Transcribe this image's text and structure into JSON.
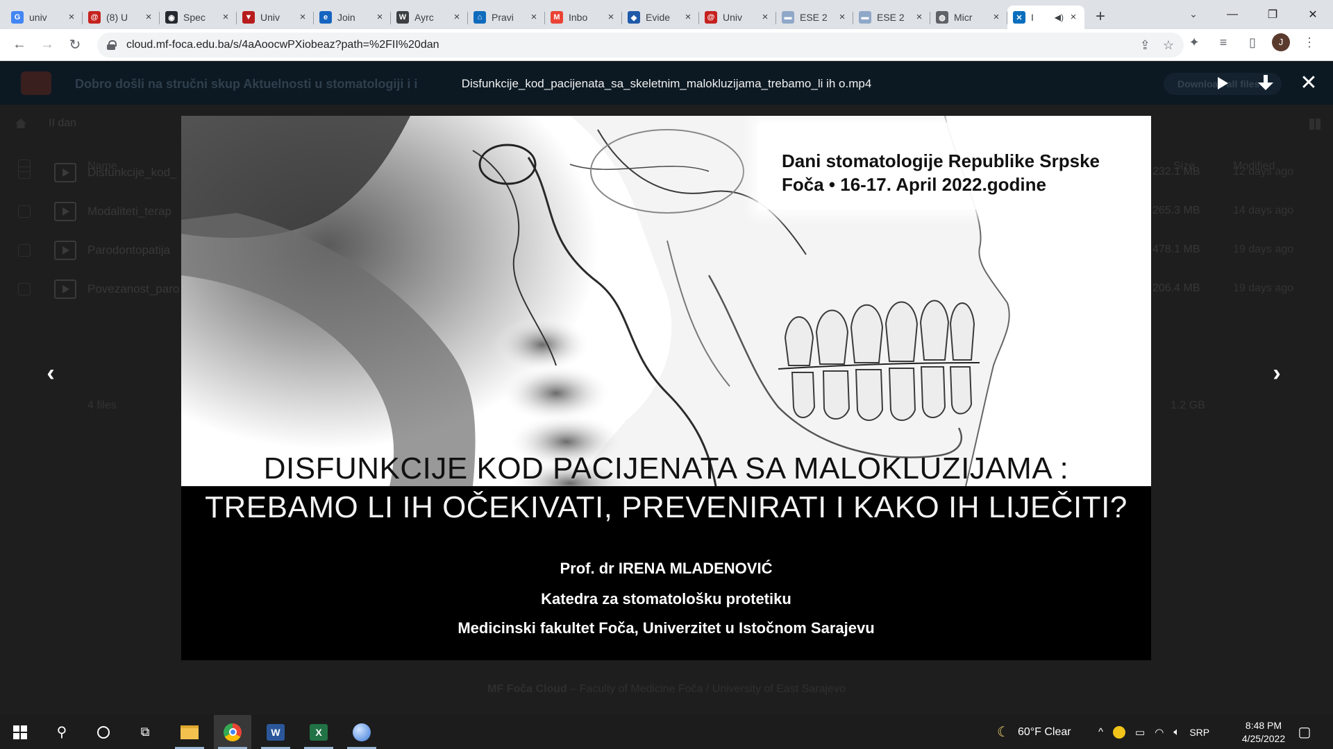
{
  "browser": {
    "tabs": [
      {
        "title": "univ",
        "icon": "google-icon",
        "color": "#4285f4",
        "glyph": "G"
      },
      {
        "title": "(8) U",
        "icon": "mail-icon",
        "color": "#c5221f",
        "glyph": "@"
      },
      {
        "title": "Spec",
        "icon": "github-icon",
        "color": "#24292f",
        "glyph": "◉"
      },
      {
        "title": "Univ",
        "icon": "university-crest-icon",
        "color": "#b71c1c",
        "glyph": "▼"
      },
      {
        "title": "Join",
        "icon": "edge-icon",
        "color": "#1565c0",
        "glyph": "e"
      },
      {
        "title": "Ayrc",
        "icon": "wordpress-icon",
        "color": "#3c4043",
        "glyph": "W"
      },
      {
        "title": "Pravi",
        "icon": "office-icon",
        "color": "#0f6cbd",
        "glyph": "⌂"
      },
      {
        "title": "Inbo",
        "icon": "gmail-icon",
        "color": "#ea4335",
        "glyph": "M"
      },
      {
        "title": "Evide",
        "icon": "shield-icon",
        "color": "#1e5aa8",
        "glyph": "◆"
      },
      {
        "title": "Univ",
        "icon": "mail-icon",
        "color": "#c5221f",
        "glyph": "@"
      },
      {
        "title": "ESE 2",
        "icon": "flag-icon",
        "color": "#8fa8c8",
        "glyph": "▬"
      },
      {
        "title": "ESE 2",
        "icon": "flag-icon",
        "color": "#8fa8c8",
        "glyph": "▬"
      },
      {
        "title": "Micr",
        "icon": "globe-icon",
        "color": "#5f6368",
        "glyph": "◍"
      },
      {
        "title": "I",
        "icon": "nextcloud-icon",
        "color": "#0a6ebd",
        "glyph": "✕",
        "active": true,
        "audio": true
      }
    ],
    "new_tab": "+",
    "url": "cloud.mf-foca.edu.ba/s/4aAoocwPXiobeaz?path=%2FII%20dan",
    "profile_initial": "J"
  },
  "page": {
    "header_title": "Dobro došli na stručni skup Aktuelnosti u stomatologiji i i",
    "download_all": "Download all files",
    "breadcrumb": "II dan",
    "columns": {
      "name": "Name",
      "size": "Size",
      "modified": "Modified"
    },
    "files": [
      {
        "name": "Disfunkcije_kod_",
        "size": "232.1 MB",
        "modified": "12 days ago"
      },
      {
        "name": "Modaliteti_terap",
        "size": "265.3 MB",
        "modified": "14 days ago"
      },
      {
        "name": "Parodontopatija",
        "size": "478.1 MB",
        "modified": "19 days ago"
      },
      {
        "name": "Povezanost_paro",
        "size": "206.4 MB",
        "modified": "19 days ago"
      }
    ],
    "files_count": "4 files",
    "total_size": "1.2 GB",
    "footer_brand": "MF Foča Cloud",
    "footer_text": " – Faculty of Medicine Foča / University of East Sarajevo"
  },
  "viewer": {
    "filename": "Disfunkcije_kod_pacijenata_sa_skeletnim_malokluzijama_trebamo_li ih o.mp4",
    "prev": "‹",
    "next": "›",
    "close": "✕"
  },
  "slide": {
    "conference_line_1": "Dani stomatologije Republike Srpske",
    "conference_line_2": "Foča • 16-17. April 2022.godine",
    "title_line_1": "DISFUNKCIJE KOD PACIJENATA SA MALOKLUZIJAMA :",
    "title_line_2": "TREBAMO LI IH OČEKIVATI, PREVENIRATI I KAKO IH LIJEČITI?",
    "author": "Prof. dr IRENA MLADENOVIĆ",
    "department": "Katedra za stomatološku protetiku",
    "faculty": "Medicinski fakultet Foča, Univerzitet u Istočnom Sarajevu"
  },
  "taskbar": {
    "weather": "60°F  Clear",
    "language": "SRP",
    "time": "8:48 PM",
    "date": "4/25/2022"
  }
}
